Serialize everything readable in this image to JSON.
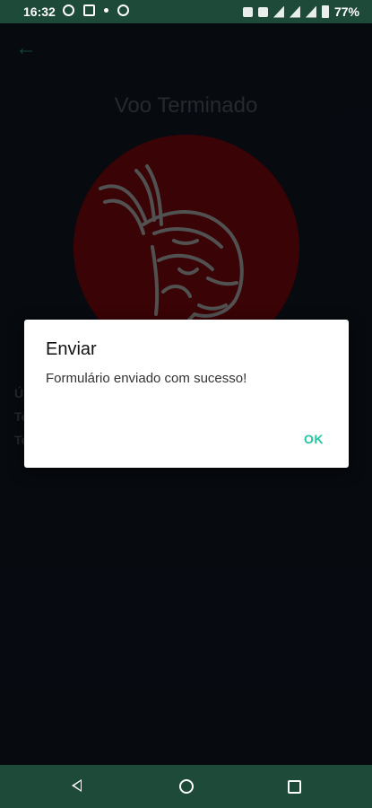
{
  "status_bar": {
    "time": "16:32",
    "battery": "77%"
  },
  "screen": {
    "title": "Voo Terminado",
    "partial_rows": [
      "Ú",
      "Te",
      "Te"
    ]
  },
  "dialog": {
    "title": "Enviar",
    "message": "Formulário enviado com sucesso!",
    "ok_label": "OK"
  },
  "colors": {
    "status_bar": "#1e4a3a",
    "background": "#0b1018",
    "accent": "#22c7a3",
    "logo_circle": "#5a0608"
  }
}
